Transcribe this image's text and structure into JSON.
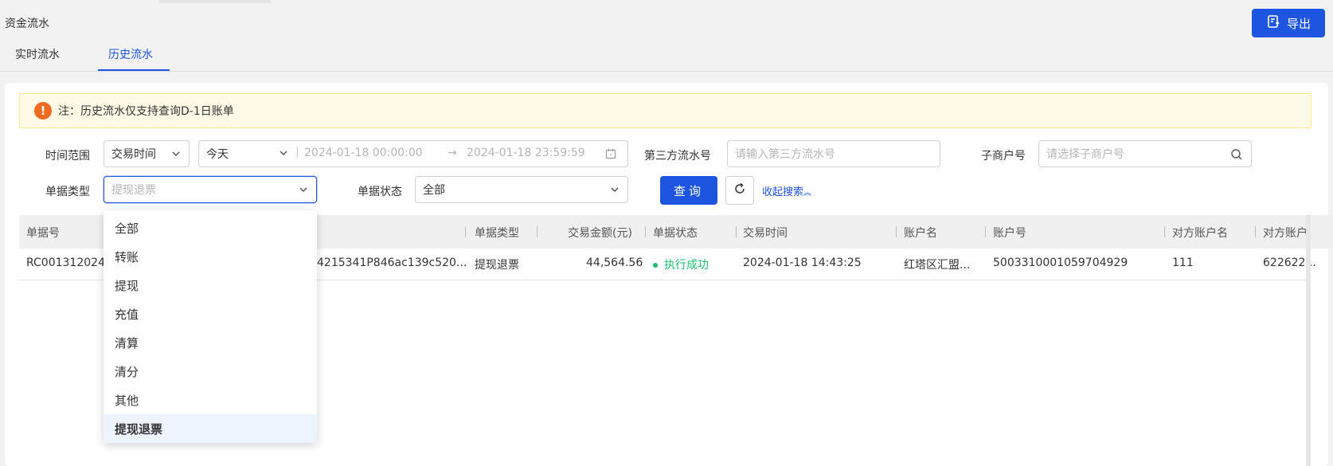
{
  "page": {
    "title": "资金流水"
  },
  "header": {
    "export_label": "导出",
    "export_icon": "export-icon"
  },
  "tabs": [
    {
      "label": "实时流水"
    },
    {
      "label": "历史流水"
    }
  ],
  "notice": {
    "text": "注：历史流水仅支持查询D-1日账单",
    "icon": "warning-icon",
    "color": "#f06a22"
  },
  "filters": {
    "time_range_label": "时间范围",
    "time_type_value": "交易时间",
    "time_preset_value": "今天",
    "start_datetime": "2024-01-18 00:00:00",
    "end_datetime": "2024-01-18 23:59:59",
    "range_separator": "→",
    "third_party_label": "第三方流水号",
    "third_party_placeholder": "请输入第三方流水号",
    "sub_merchant_label": "子商户号",
    "sub_merchant_placeholder": "请选择子商户号",
    "doc_type_label": "单据类型",
    "doc_type_value": "提现退票",
    "doc_status_label": "单据状态",
    "doc_status_value": "全部",
    "query_label": "查询",
    "collapse_label": "收起搜索"
  },
  "doc_type_options": [
    "全部",
    "转账",
    "提现",
    "充值",
    "清算",
    "清分",
    "其他",
    "提现退票"
  ],
  "table": {
    "columns": [
      "单据号",
      "单据类型",
      "交易金额(元)",
      "单据状态",
      "交易时间",
      "账户名",
      "账户号",
      "对方账户名",
      "对方账户"
    ],
    "rows": [
      {
        "doc_no": "RC0013120240",
        "third_party_no": "4215341P846ac139c520...",
        "doc_type": "提现退票",
        "amount": "44,564.56",
        "status": "执行成功",
        "time": "2024-01-18 14:43:25",
        "account_name": "红塔区汇盟...",
        "account_no": "5003310001059704929",
        "counter_name": "111",
        "counter_account": "622622..."
      }
    ]
  },
  "colors": {
    "primary": "#1d55e0",
    "success": "#1dbf73",
    "warning": "#f06a22"
  }
}
